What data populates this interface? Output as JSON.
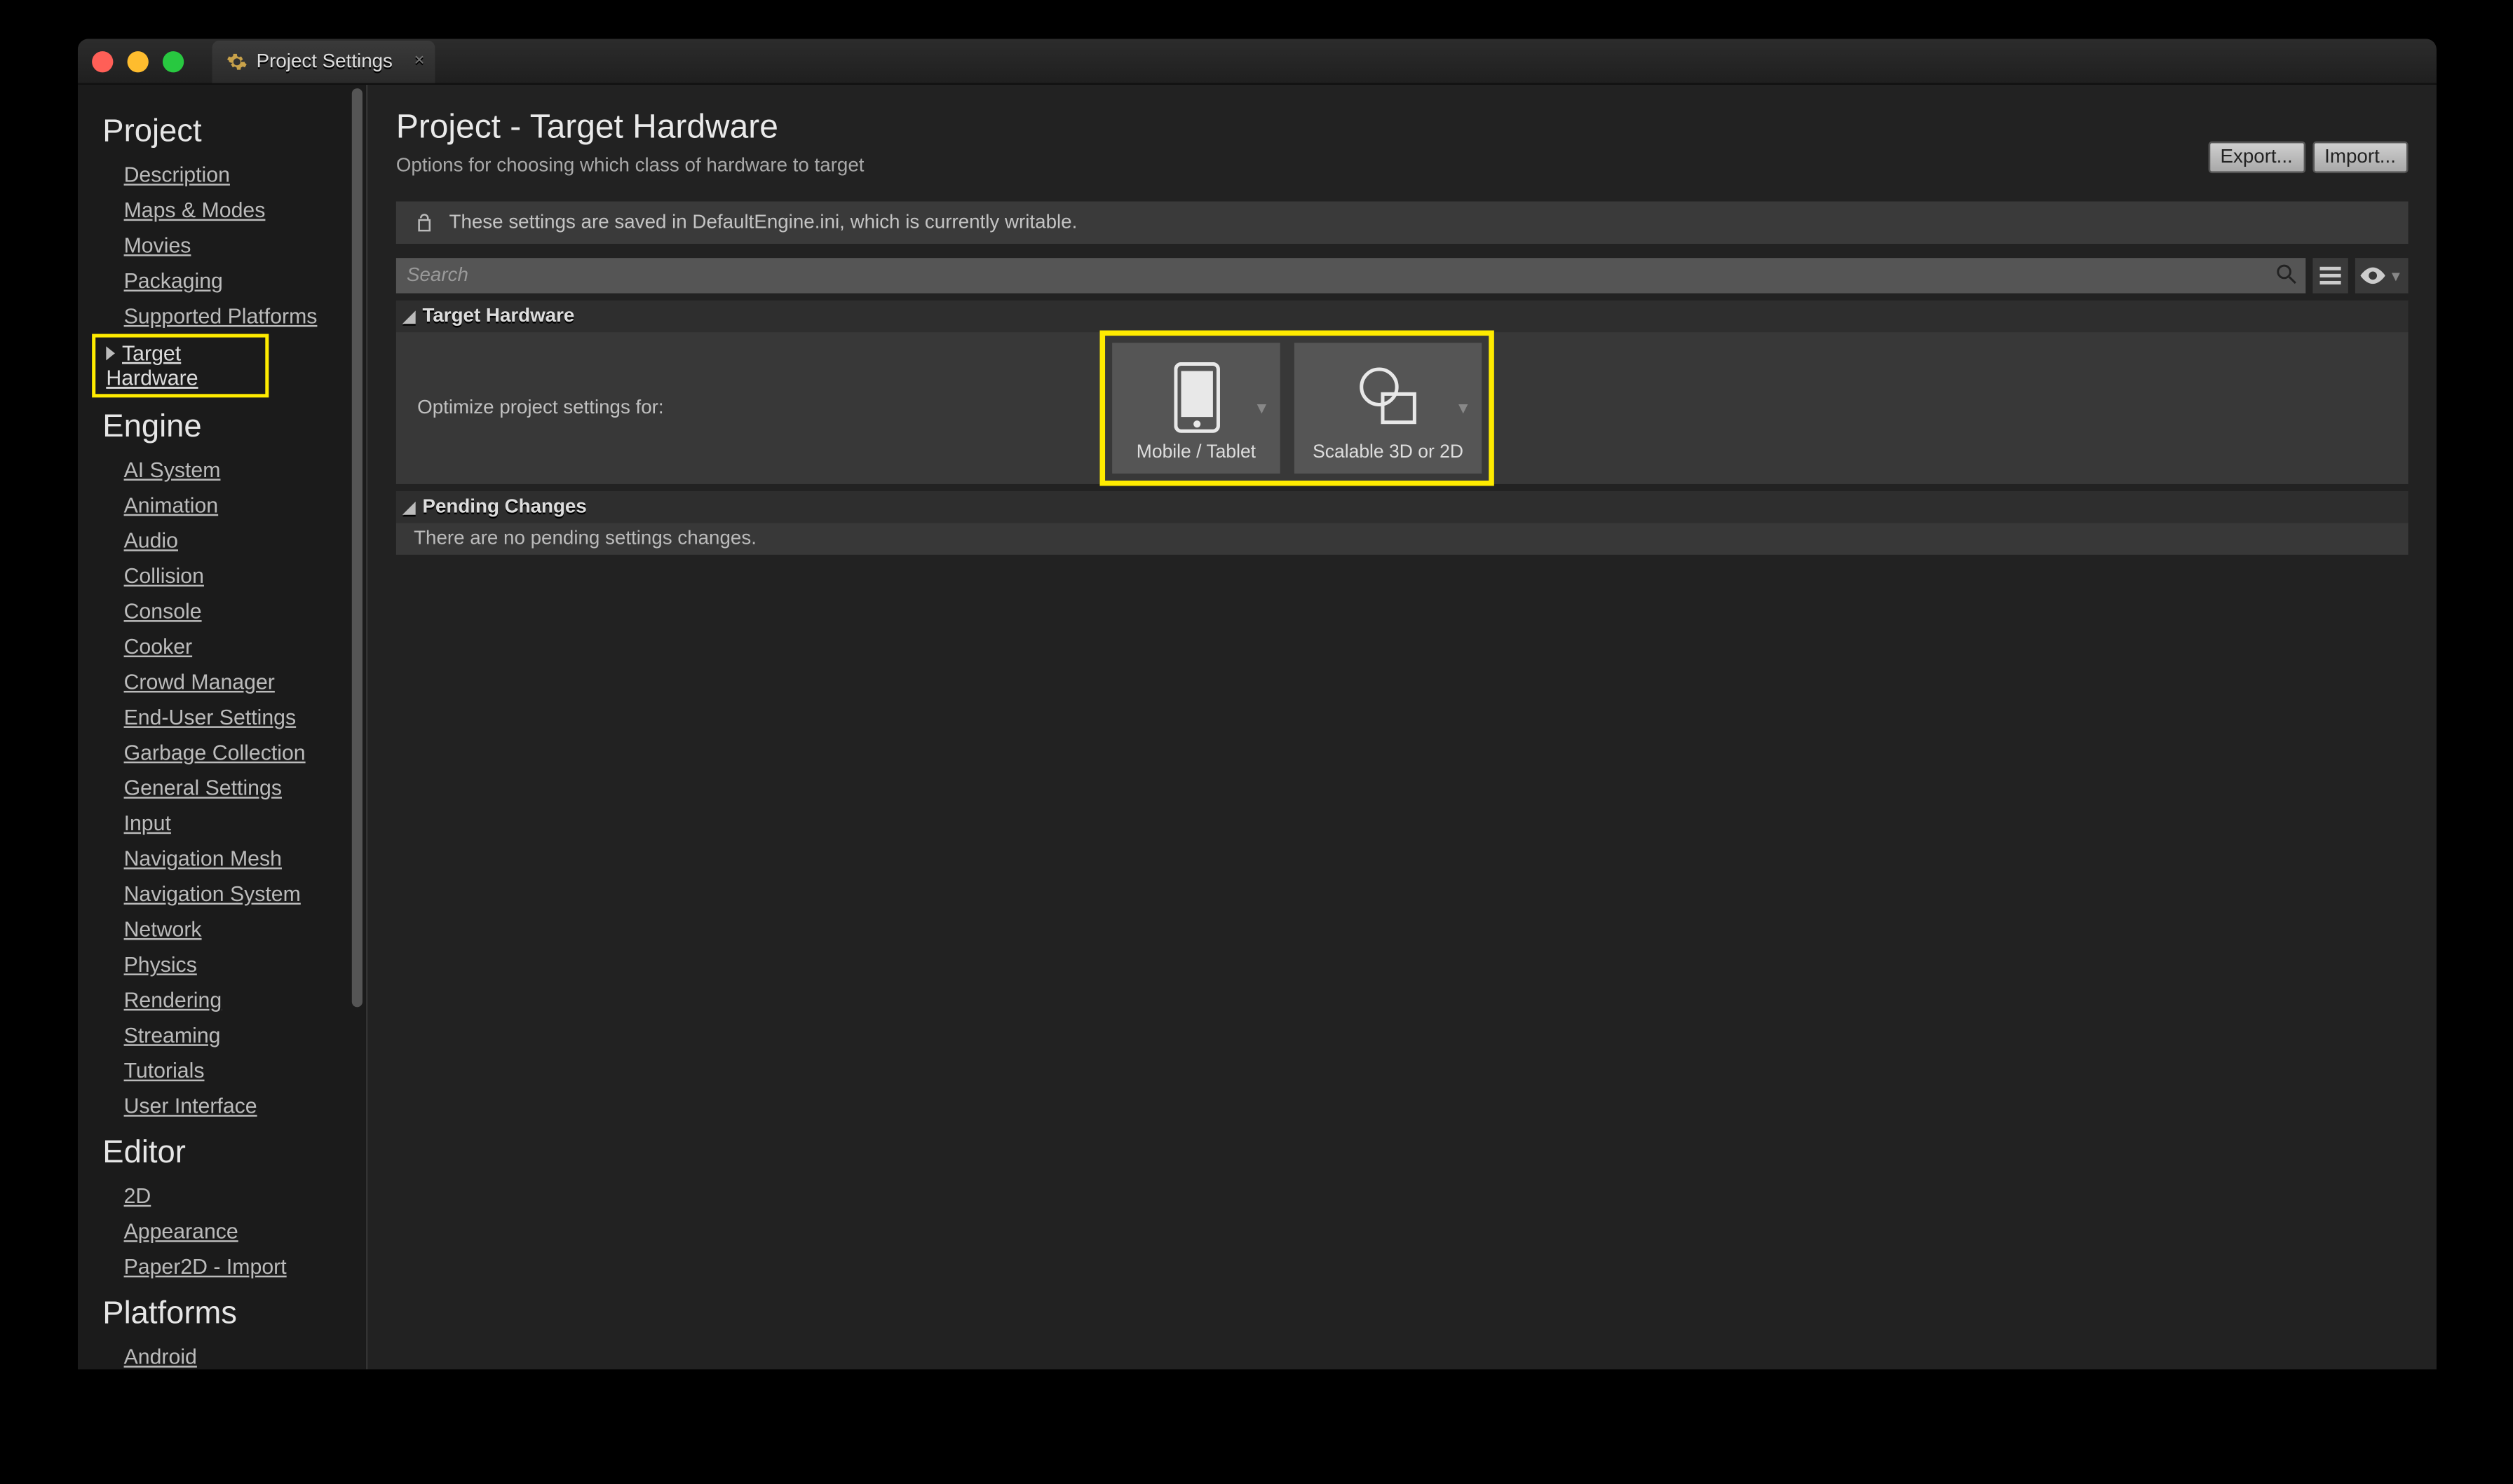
{
  "tab": {
    "title": "Project Settings",
    "close": "×"
  },
  "header": {
    "title": "Project - Target Hardware",
    "subtitle": "Options for choosing which class of hardware to target",
    "export": "Export...",
    "import": "Import..."
  },
  "info": {
    "text": "These settings are saved in DefaultEngine.ini, which is currently writable."
  },
  "search": {
    "placeholder": "Search"
  },
  "sections": {
    "target_hw": "Target Hardware",
    "pending": "Pending Changes"
  },
  "optimize": {
    "label": "Optimize project settings for:",
    "option1": "Mobile / Tablet",
    "option2": "Scalable 3D or 2D"
  },
  "pending_msg": "There are no pending settings changes.",
  "sidebar": {
    "groups": [
      {
        "heading": "Project",
        "items": [
          "Description",
          "Maps & Modes",
          "Movies",
          "Packaging",
          "Supported Platforms"
        ],
        "selected": "Target Hardware"
      },
      {
        "heading": "Engine",
        "items": [
          "AI System",
          "Animation",
          "Audio",
          "Collision",
          "Console",
          "Cooker",
          "Crowd Manager",
          "End-User Settings",
          "Garbage Collection",
          "General Settings",
          "Input",
          "Navigation Mesh",
          "Navigation System",
          "Network",
          "Physics",
          "Rendering",
          "Streaming",
          "Tutorials",
          "User Interface"
        ]
      },
      {
        "heading": "Editor",
        "items": [
          "2D",
          "Appearance",
          "Paper2D - Import"
        ]
      },
      {
        "heading": "Platforms",
        "items": [
          "Android"
        ]
      }
    ]
  }
}
